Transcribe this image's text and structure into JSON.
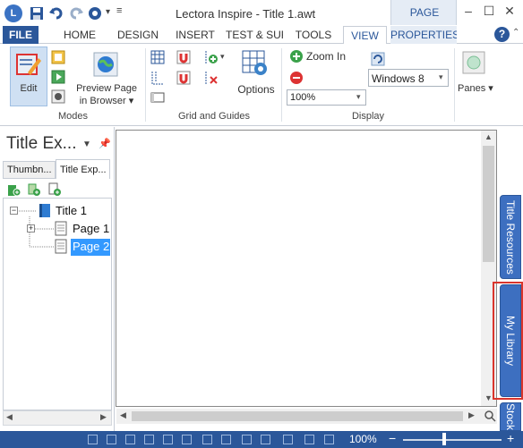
{
  "titlebar": {
    "title": "Lectora Inspire - Title 1.awt",
    "context_group": "PAGE",
    "app_logo": "L"
  },
  "tabs": [
    "FILE",
    "HOME",
    "DESIGN",
    "INSERT",
    "TEST & SURV",
    "TOOLS",
    "VIEW",
    "PROPERTIES"
  ],
  "help_label": "?",
  "ribbon": {
    "modes": {
      "label": "Modes",
      "edit": "Edit",
      "preview_line1": "Preview Page",
      "preview_line2": "in Browser ▾"
    },
    "grid": {
      "label": "Grid and Guides",
      "options": "Options"
    },
    "display": {
      "label": "Display",
      "zoom_in": "Zoom In",
      "zoom_value": "100%",
      "theme": "Windows 8"
    },
    "panes": {
      "label": "Panes ▾"
    }
  },
  "left_panel": {
    "title": "Title Ex...",
    "tabs": [
      "Thumbn...",
      "Title Exp..."
    ],
    "tree": [
      {
        "label": "Title 1"
      },
      {
        "label": "Page 1"
      },
      {
        "label": "Page 2"
      }
    ]
  },
  "side_tabs": [
    "Title Resources",
    "My Library",
    "Stock Lib"
  ],
  "status": {
    "zoom": "100%"
  },
  "colors": {
    "accent": "#2b579a",
    "side_tab": "#3d6fc0",
    "selection": "#3399ff",
    "highlight": "#d9352d"
  }
}
